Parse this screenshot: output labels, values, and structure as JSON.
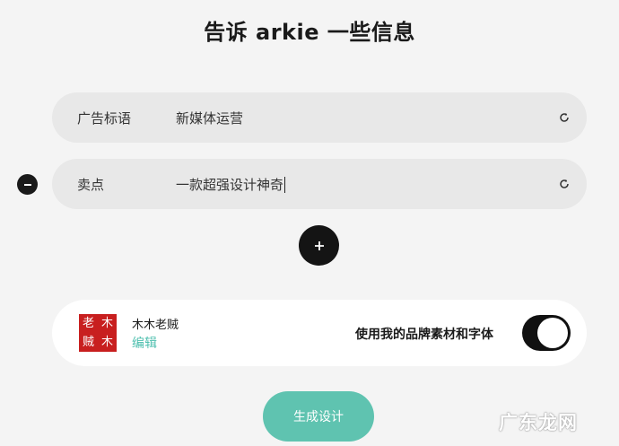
{
  "header": {
    "title": "告诉 arkie 一些信息"
  },
  "fields": [
    {
      "label": "广告标语",
      "value": "新媒体运营"
    },
    {
      "label": "卖点",
      "value": "一款超强设计神奇"
    }
  ],
  "brand": {
    "logo_chars": [
      "老",
      "木",
      "贼",
      "木"
    ],
    "name": "木木老贼",
    "edit_label": "编辑",
    "toggle_label": "使用我的品牌素材和字体",
    "toggle_on": true
  },
  "actions": {
    "generate_label": "生成设计"
  },
  "watermark": "广东龙网",
  "colors": {
    "accent": "#5fc3b0",
    "edit_link": "#4dbfae",
    "logo_bg": "#c81f1f"
  }
}
